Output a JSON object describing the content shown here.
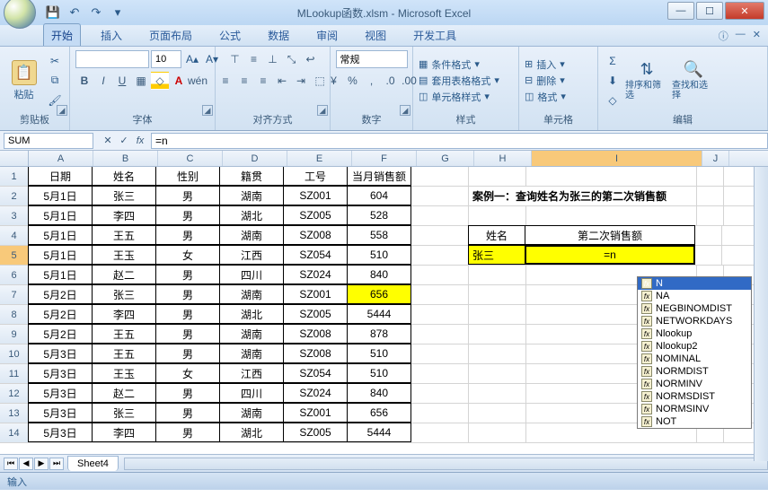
{
  "title": "MLookup函数.xlsm - Microsoft Excel",
  "tabs": [
    "开始",
    "插入",
    "页面布局",
    "公式",
    "数据",
    "审阅",
    "视图",
    "开发工具"
  ],
  "ribbon": {
    "clipboard": "剪贴板",
    "paste": "粘贴",
    "font": "字体",
    "font_size": "10",
    "align": "对齐方式",
    "number": "数字",
    "number_fmt": "常规",
    "styles": "样式",
    "cond_fmt": "条件格式",
    "table_fmt": "套用表格格式",
    "cell_styles": "单元格样式",
    "cells": "单元格",
    "insert": "插入",
    "delete": "删除",
    "format": "格式",
    "editing": "编辑",
    "sort": "排序和筛选",
    "find": "查找和选择"
  },
  "namebox": "SUM",
  "formula": "=n",
  "columns": [
    "A",
    "B",
    "C",
    "D",
    "E",
    "F",
    "G",
    "H",
    "I",
    "J"
  ],
  "headers": [
    "日期",
    "姓名",
    "性别",
    "籍贯",
    "工号",
    "当月销售额"
  ],
  "rows": [
    [
      "5月1日",
      "张三",
      "男",
      "湖南",
      "SZ001",
      "604"
    ],
    [
      "5月1日",
      "李四",
      "男",
      "湖北",
      "SZ005",
      "528"
    ],
    [
      "5月1日",
      "王五",
      "男",
      "湖南",
      "SZ008",
      "558"
    ],
    [
      "5月1日",
      "王玉",
      "女",
      "江西",
      "SZ054",
      "510"
    ],
    [
      "5月1日",
      "赵二",
      "男",
      "四川",
      "SZ024",
      "840"
    ],
    [
      "5月2日",
      "张三",
      "男",
      "湖南",
      "SZ001",
      "656"
    ],
    [
      "5月2日",
      "李四",
      "男",
      "湖北",
      "SZ005",
      "5444"
    ],
    [
      "5月2日",
      "王五",
      "男",
      "湖南",
      "SZ008",
      "878"
    ],
    [
      "5月3日",
      "王五",
      "男",
      "湖南",
      "SZ008",
      "510"
    ],
    [
      "5月3日",
      "王玉",
      "女",
      "江西",
      "SZ054",
      "510"
    ],
    [
      "5月3日",
      "赵二",
      "男",
      "四川",
      "SZ024",
      "840"
    ],
    [
      "5月3日",
      "张三",
      "男",
      "湖南",
      "SZ001",
      "656"
    ],
    [
      "5月3日",
      "李四",
      "男",
      "湖北",
      "SZ005",
      "5444"
    ]
  ],
  "case_title": "案例一：查询姓名为张三的第二次销售额",
  "lookup_hdr": [
    "姓名",
    "第二次销售额"
  ],
  "lookup_name": "张三",
  "lookup_formula": "=n",
  "autocomplete": [
    "N",
    "NA",
    "NEGBINOMDIST",
    "NETWORKDAYS",
    "Nlookup",
    "Nlookup2",
    "NOMINAL",
    "NORMDIST",
    "NORMINV",
    "NORMSDIST",
    "NORMSINV",
    "NOT"
  ],
  "sheet": "Sheet4",
  "status": "输入"
}
